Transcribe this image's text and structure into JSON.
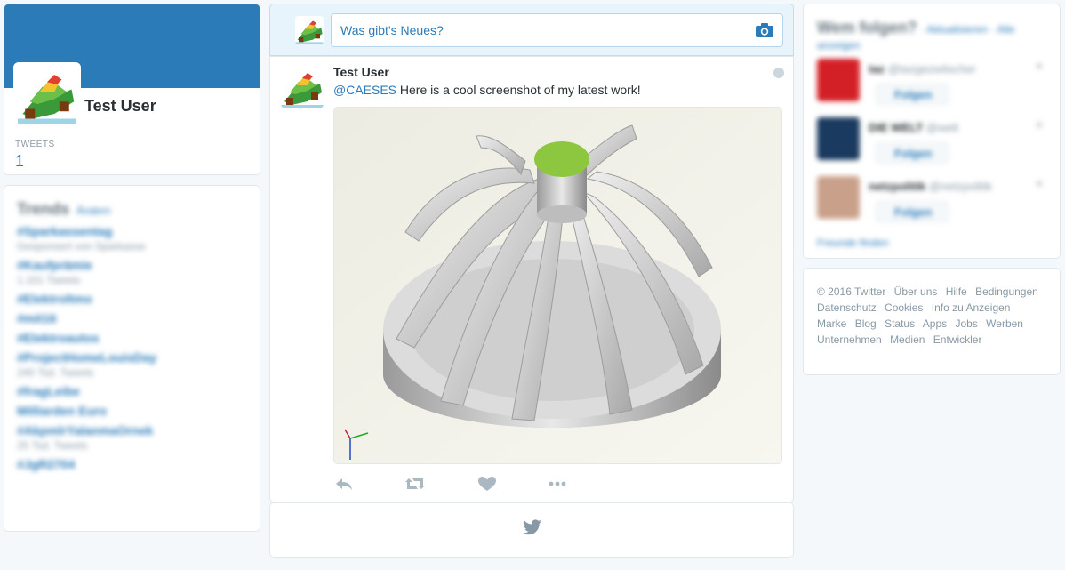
{
  "profile": {
    "name": "Test User",
    "stat_label": "TWEETS",
    "stat_value": "1"
  },
  "trends": {
    "title": "Trends",
    "change_label": "Ändern",
    "items": [
      {
        "name": "#Sparkassentag",
        "sub": "Gesponsert von Sparkasse"
      },
      {
        "name": "#Kaufprämie",
        "sub": "1.101 Tweets"
      },
      {
        "name": "#Elektroltmo",
        "sub": ""
      },
      {
        "name": "#mit16",
        "sub": ""
      },
      {
        "name": "#Elektroautos",
        "sub": ""
      },
      {
        "name": "#ProjectHomeLouisDay",
        "sub": "240 Tsd. Tweets"
      },
      {
        "name": "#fragLeibe",
        "sub": ""
      },
      {
        "name": "Milliarden Euro",
        "sub": ""
      },
      {
        "name": "#AkpmlrYalanmaOrnek",
        "sub": "25 Tsd. Tweets"
      },
      {
        "name": "#JgR2704",
        "sub": ""
      }
    ]
  },
  "composer": {
    "placeholder": "Was gibt's Neues?",
    "camera_icon": "camera-icon"
  },
  "tweet": {
    "author": "Test User",
    "mention": "@CAESES",
    "text": " Here is a cool screenshot of my latest work!",
    "actions": [
      "reply-icon",
      "retweet-icon",
      "like-icon",
      "more-icon"
    ]
  },
  "who_to_follow": {
    "title": "Wem folgen?",
    "refresh": "· Aktualisieren",
    "all": "· Alle anzeigen",
    "suggestions": [
      {
        "name": "taz",
        "handle": "@tazgezwitscher",
        "follow": "Folgen",
        "color": "#d32027"
      },
      {
        "name": "DIE WELT",
        "handle": "@welt",
        "follow": "Folgen",
        "color": "#1a3a5f"
      },
      {
        "name": "netzpolitik",
        "handle": "@netzpolitik",
        "follow": "Folgen",
        "color": "#c9a08a"
      }
    ],
    "find_friends": "Freunde finden"
  },
  "footer": {
    "links": [
      "© 2016 Twitter",
      "Über uns",
      "Hilfe",
      "Bedingungen",
      "Datenschutz",
      "Cookies",
      "Info zu Anzeigen",
      "Marke",
      "Blog",
      "Status",
      "Apps",
      "Jobs",
      "Werben",
      "Unternehmen",
      "Medien",
      "Entwickler"
    ]
  },
  "colors": {
    "accent": "#2b7bb9",
    "background": "#f5f8fa",
    "impeller_cap": "#8dc63f"
  }
}
